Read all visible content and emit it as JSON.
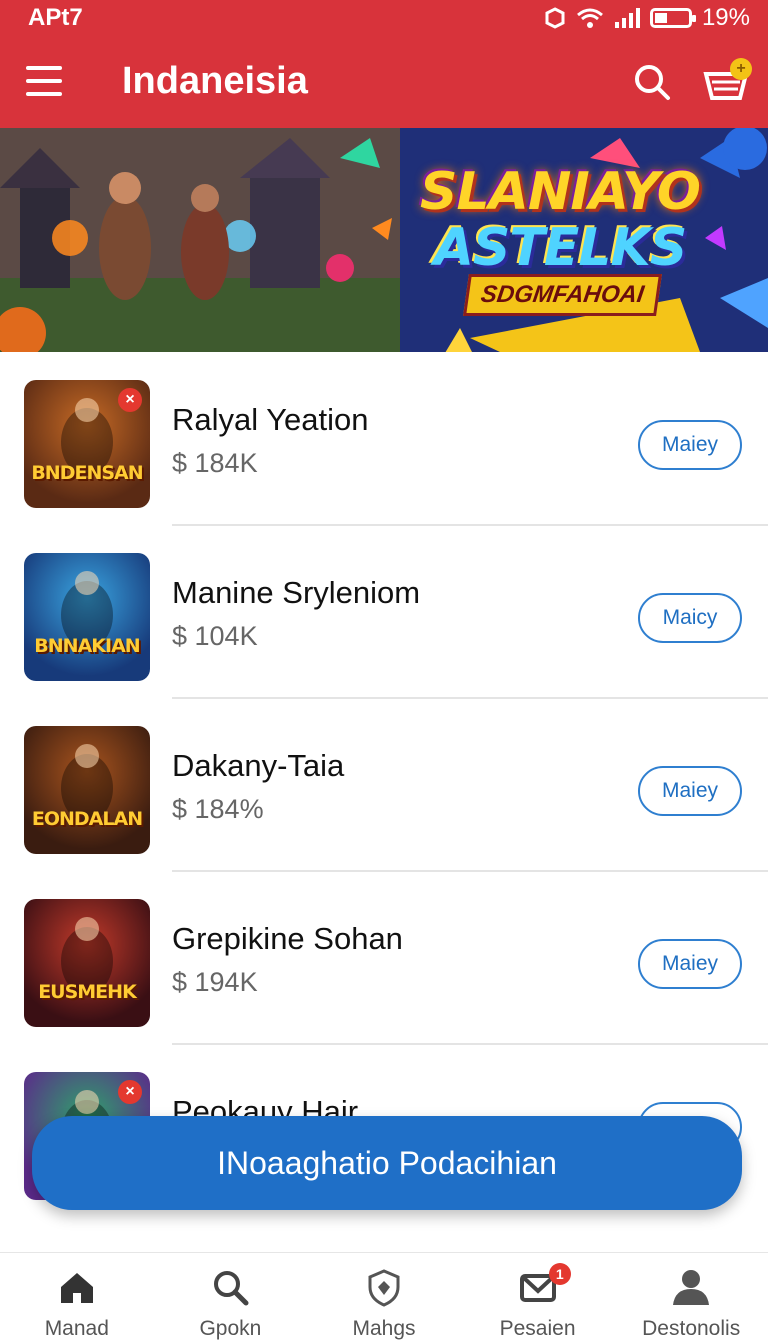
{
  "status_bar": {
    "time": "APt7",
    "battery": "19%",
    "battery_level": 0.19
  },
  "app_bar": {
    "title": "Indaneisia",
    "cart_badge": "+"
  },
  "banner": {
    "title_line1": "SLANIAYO",
    "title_line2": "ASTELKS",
    "tagline": "SDGMFAHOAI"
  },
  "games": [
    {
      "name": "Ralyal Yeation",
      "price": "$ 184K",
      "button": "Maiey",
      "thumb_text": "BNDENSAN",
      "has_badge": true,
      "thumb_colors": [
        "#5a2a14",
        "#c66a25"
      ]
    },
    {
      "name": "Manine Sryleniom",
      "price": "$ 104K",
      "button": "Maicy",
      "thumb_text": "BNNAKIAN",
      "has_badge": false,
      "thumb_colors": [
        "#173a7a",
        "#3aa4e0"
      ]
    },
    {
      "name": "Dakany-Taia",
      "price": "$ 184%",
      "button": "Maiey",
      "thumb_text": "EONDALAN",
      "has_badge": false,
      "thumb_colors": [
        "#3a1c10",
        "#a8541e"
      ]
    },
    {
      "name": "Grepikine Sohan",
      "price": "$ 194K",
      "button": "Maiey",
      "thumb_text": "EUSMEHK",
      "has_badge": false,
      "thumb_colors": [
        "#3a0f14",
        "#c23a2a"
      ]
    },
    {
      "name": "Peokauy Hair",
      "price": "",
      "button": "",
      "thumb_text": "",
      "has_badge": true,
      "thumb_colors": [
        "#5b2a8a",
        "#2fa36b"
      ]
    }
  ],
  "cta": {
    "label": "INoaaghatio Podacihian"
  },
  "bottom_nav": [
    {
      "label": "Manad",
      "icon": "home-icon"
    },
    {
      "label": "Gpokn",
      "icon": "search-icon"
    },
    {
      "label": "Mahgs",
      "icon": "shield-icon"
    },
    {
      "label": "Pesaien",
      "icon": "mail-icon",
      "badge": "1"
    },
    {
      "label": "Destonolis",
      "icon": "profile-icon"
    }
  ],
  "colors": {
    "header": "#d8333b",
    "accent": "#1f6fc7",
    "button_border": "#2f7fd0"
  }
}
